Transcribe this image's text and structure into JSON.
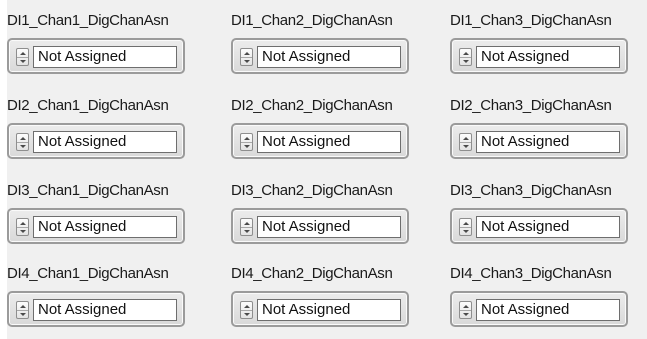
{
  "rows": [
    {
      "cells": [
        {
          "label": "DI1_Chan1_DigChanAsn",
          "value": "Not Assigned"
        },
        {
          "label": "DI1_Chan2_DigChanAsn",
          "value": "Not Assigned"
        },
        {
          "label": "DI1_Chan3_DigChanAsn",
          "value": "Not Assigned"
        }
      ]
    },
    {
      "cells": [
        {
          "label": "DI2_Chan1_DigChanAsn",
          "value": "Not Assigned"
        },
        {
          "label": "DI2_Chan2_DigChanAsn",
          "value": "Not Assigned"
        },
        {
          "label": "DI2_Chan3_DigChanAsn",
          "value": "Not Assigned"
        }
      ]
    },
    {
      "cells": [
        {
          "label": "DI3_Chan1_DigChanAsn",
          "value": "Not Assigned"
        },
        {
          "label": "DI3_Chan2_DigChanAsn",
          "value": "Not Assigned"
        },
        {
          "label": "DI3_Chan3_DigChanAsn",
          "value": "Not Assigned"
        }
      ]
    },
    {
      "cells": [
        {
          "label": "DI4_Chan1_DigChanAsn",
          "value": "Not Assigned"
        },
        {
          "label": "DI4_Chan2_DigChanAsn",
          "value": "Not Assigned"
        },
        {
          "label": "DI4_Chan3_DigChanAsn",
          "value": "Not Assigned"
        }
      ]
    }
  ],
  "icons": {
    "increment": "triangle-up-icon",
    "decrement": "triangle-down-icon"
  },
  "colors": {
    "panel_background": "#f0f0f0",
    "text": "#1a1a1a",
    "frame_border": "#9b9b9b",
    "value_background": "#ffffff"
  }
}
